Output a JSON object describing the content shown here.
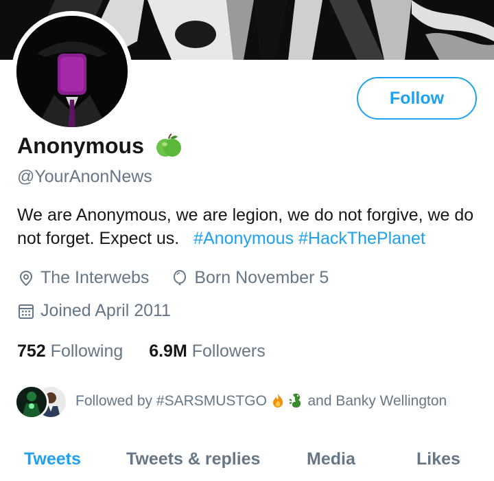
{
  "profile": {
    "display_name": "Anonymous",
    "name_emoji": "green-apple",
    "handle": "@YourAnonNews",
    "bio_text": "We are Anonymous, we are legion, we do not forgive, we do not forget. Expect us.",
    "bio_hashtags": [
      "#Anonymous",
      "#HackThePlanet"
    ],
    "location": "The Interwebs",
    "birthday": "Born November 5",
    "joined": "Joined April 2011"
  },
  "actions": {
    "follow_label": "Follow"
  },
  "stats": {
    "following_count": "752",
    "following_label": "Following",
    "followers_count": "6.9M",
    "followers_label": "Followers"
  },
  "followed_by": {
    "prefix": "Followed by",
    "first": "#SARSMUSTGO",
    "suffix": "and Banky Wellington"
  },
  "tabs": [
    {
      "label": "Tweets",
      "active": true
    },
    {
      "label": "Tweets & replies",
      "active": false
    },
    {
      "label": "Media",
      "active": false
    },
    {
      "label": "Likes",
      "active": false
    }
  ],
  "colors": {
    "accent": "#1da1f2",
    "secondary_text": "#657786",
    "primary_text": "#14171a"
  },
  "icons": [
    "location-pin-icon",
    "balloon-icon",
    "calendar-icon",
    "fire-emoji",
    "dragon-emoji",
    "green-apple-emoji"
  ]
}
